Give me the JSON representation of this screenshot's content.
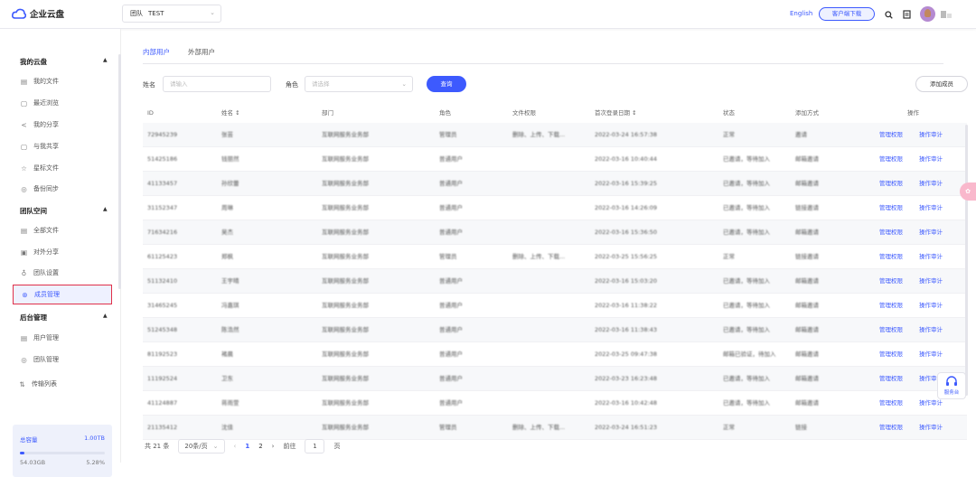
{
  "header": {
    "app_name": "企业云盘",
    "team_label": "团队",
    "team_name": "TEST",
    "lang": "English",
    "client_download": "客户端下载"
  },
  "sidebar": {
    "my_cloud": {
      "title": "我的云盘",
      "items": [
        {
          "label": "我的文件",
          "icon": "file-icon"
        },
        {
          "label": "最近浏览",
          "icon": "recent-icon"
        },
        {
          "label": "我的分享",
          "icon": "share-icon"
        },
        {
          "label": "与我共享",
          "icon": "shared-icon"
        },
        {
          "label": "星标文件",
          "icon": "star-icon"
        },
        {
          "label": "备份同步",
          "icon": "sync-icon"
        }
      ]
    },
    "team_space": {
      "title": "团队空间",
      "items": [
        {
          "label": "全部文件",
          "icon": "file-icon"
        },
        {
          "label": "对外分享",
          "icon": "share-icon"
        },
        {
          "label": "团队设置",
          "icon": "team-settings-icon"
        },
        {
          "label": "成员管理",
          "icon": "member-icon"
        }
      ]
    },
    "admin": {
      "title": "后台管理",
      "items": [
        {
          "label": "用户管理",
          "icon": "user-manage-icon"
        },
        {
          "label": "团队管理",
          "icon": "team-manage-icon"
        }
      ]
    },
    "transfer": {
      "label": "传输列表",
      "icon": "transfer-icon"
    },
    "storage": {
      "total_label": "总容量",
      "total": "1.00TB",
      "used": "54.03GB",
      "percent": "5.28%",
      "fraction": 0.0528
    }
  },
  "main": {
    "tabs": [
      "内部用户",
      "外部用户"
    ],
    "filters": {
      "name_label": "姓名",
      "name_placeholder": "请输入",
      "role_label": "角色",
      "role_placeholder": "请选择",
      "query": "查询",
      "add_member": "添加成员"
    },
    "columns": [
      "ID",
      "姓名 ↕",
      "部门",
      "角色",
      "文件权限",
      "首次登录日期 ↕",
      "状态",
      "添加方式",
      "操作"
    ],
    "rows": [
      [
        "72945239",
        "张芸",
        "互联网服务业务部",
        "管理员",
        "删除、上传、下载...",
        "2022-03-24 16:57:38",
        "正常",
        "邀请"
      ],
      [
        "51425186",
        "钱丽然",
        "互联网服务业务部",
        "普通用户",
        "",
        "2022-03-16 10:40:44",
        "已邀请，等待加入",
        "邮箱邀请"
      ],
      [
        "41133457",
        "孙欣蕾",
        "互联网服务业务部",
        "普通用户",
        "",
        "2022-03-16 15:39:25",
        "已邀请，等待加入",
        "邮箱邀请"
      ],
      [
        "31152347",
        "周琳",
        "互联网服务业务部",
        "普通用户",
        "",
        "2022-03-16 14:26:09",
        "已邀请，等待加入",
        "链接邀请"
      ],
      [
        "71634216",
        "吴杰",
        "互联网服务业务部",
        "普通用户",
        "",
        "2022-03-16 15:36:50",
        "已邀请，等待加入",
        "邮箱邀请"
      ],
      [
        "61125423",
        "郑枫",
        "互联网服务业务部",
        "管理员",
        "删除、上传、下载...",
        "2022-03-25 15:56:25",
        "正常",
        "链接邀请"
      ],
      [
        "51132410",
        "王宇晴",
        "互联网服务业务部",
        "普通用户",
        "",
        "2022-03-16 15:03:20",
        "已邀请，等待加入",
        "邮箱邀请"
      ],
      [
        "31465245",
        "冯嘉琪",
        "互联网服务业务部",
        "普通用户",
        "",
        "2022-03-16 11:38:22",
        "已邀请，等待加入",
        "邮箱邀请"
      ],
      [
        "51245348",
        "陈浩然",
        "互联网服务业务部",
        "普通用户",
        "",
        "2022-03-16 11:38:43",
        "已邀请，等待加入",
        "邮箱邀请"
      ],
      [
        "81192523",
        "褚晨",
        "互联网服务业务部",
        "普通用户",
        "",
        "2022-03-25 09:47:38",
        "邮箱已验证，待加入",
        "邮箱邀请"
      ],
      [
        "11192524",
        "卫东",
        "互联网服务业务部",
        "普通用户",
        "",
        "2022-03-23 16:23:48",
        "已邀请，等待加入",
        "邮箱邀请"
      ],
      [
        "41124887",
        "蒋雨萱",
        "互联网服务业务部",
        "普通用户",
        "",
        "2022-03-16 10:42:48",
        "已邀请，等待加入",
        "邮箱邀请"
      ],
      [
        "21135412",
        "沈佳",
        "互联网服务业务部",
        "管理员",
        "删除、上传、下载...",
        "2022-03-24 16:51:23",
        "正常",
        "链接"
      ]
    ],
    "actions": [
      "管理权限",
      "操作审计"
    ],
    "pagination": {
      "total": "共 21 条",
      "page_size": "20条/页",
      "pages": [
        "1",
        "2"
      ],
      "goto_label": "前往",
      "goto_value": "1",
      "page_suffix": "页"
    }
  },
  "float": {
    "service": "服务台"
  }
}
